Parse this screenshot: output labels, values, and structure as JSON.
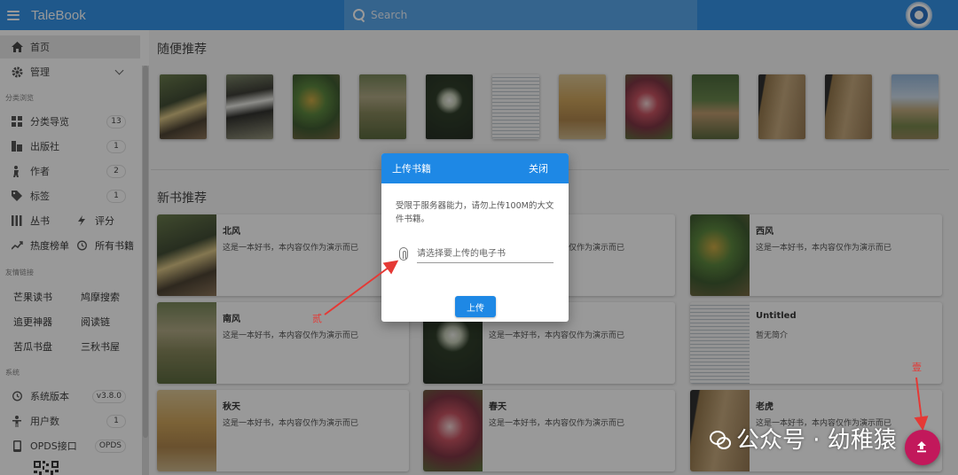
{
  "app": {
    "title": "TaleBook"
  },
  "search": {
    "placeholder": "Search"
  },
  "sidebar": {
    "home": "首页",
    "manage": "管理",
    "section_browse": "分类浏览",
    "browse_items": [
      {
        "label": "分类导览",
        "count": "13",
        "icon": "grid-icon"
      },
      {
        "label": "出版社",
        "count": "1",
        "icon": "publisher-icon"
      },
      {
        "label": "作者",
        "count": "2",
        "icon": "author-icon"
      },
      {
        "label": "标签",
        "count": "1",
        "icon": "tag-icon"
      }
    ],
    "pair1": {
      "left": "丛书",
      "right": "评分"
    },
    "pair2": {
      "left": "热度榜单",
      "right": "所有书籍"
    },
    "section_links": "友情链接",
    "links": [
      [
        "芒果读书",
        "鸠摩搜索"
      ],
      [
        "追更神器",
        "阅读链"
      ],
      [
        "苦瓜书盘",
        "三秋书屋"
      ]
    ],
    "section_system": "系统",
    "system_items": [
      {
        "label": "系统版本",
        "value": "v3.8.0"
      },
      {
        "label": "用户数",
        "value": "1"
      },
      {
        "label": "OPDS接口",
        "value": "OPDS"
      }
    ]
  },
  "main": {
    "random_title": "随便推荐",
    "new_title": "新书推荐",
    "cards": [
      {
        "title": "北风",
        "desc": "这是一本好书，本内容仅作为演示而已"
      },
      {
        "title": "",
        "desc": "这是一本好书，本内容仅作为演示而已"
      },
      {
        "title": "西风",
        "desc": "这是一本好书，本内容仅作为演示而已"
      },
      {
        "title": "南风",
        "desc": "这是一本好书，本内容仅作为演示而已"
      },
      {
        "title": "",
        "desc": "这是一本好书，本内容仅作为演示而已"
      },
      {
        "title": "Untitled",
        "desc": "暂无简介"
      },
      {
        "title": "秋天",
        "desc": "这是一本好书，本内容仅作为演示而已"
      },
      {
        "title": "春天",
        "desc": "这是一本好书，本内容仅作为演示而已"
      },
      {
        "title": "老虎",
        "desc": "这是一本好书，本内容仅作为演示而已"
      }
    ]
  },
  "dialog": {
    "title": "上传书籍",
    "close": "关闭",
    "message": "受限于服务器能力，请勿上传100M的大文件书籍。",
    "file_placeholder": "请选择要上传的电子书",
    "upload": "上传"
  },
  "annotations": {
    "step1": "壹",
    "step2": "贰"
  },
  "watermark": {
    "text": "公众号 · 幼稚猿"
  },
  "colors": {
    "primary": "#1e88e5",
    "fab": "#c2185b",
    "annotation": "#e53935"
  }
}
